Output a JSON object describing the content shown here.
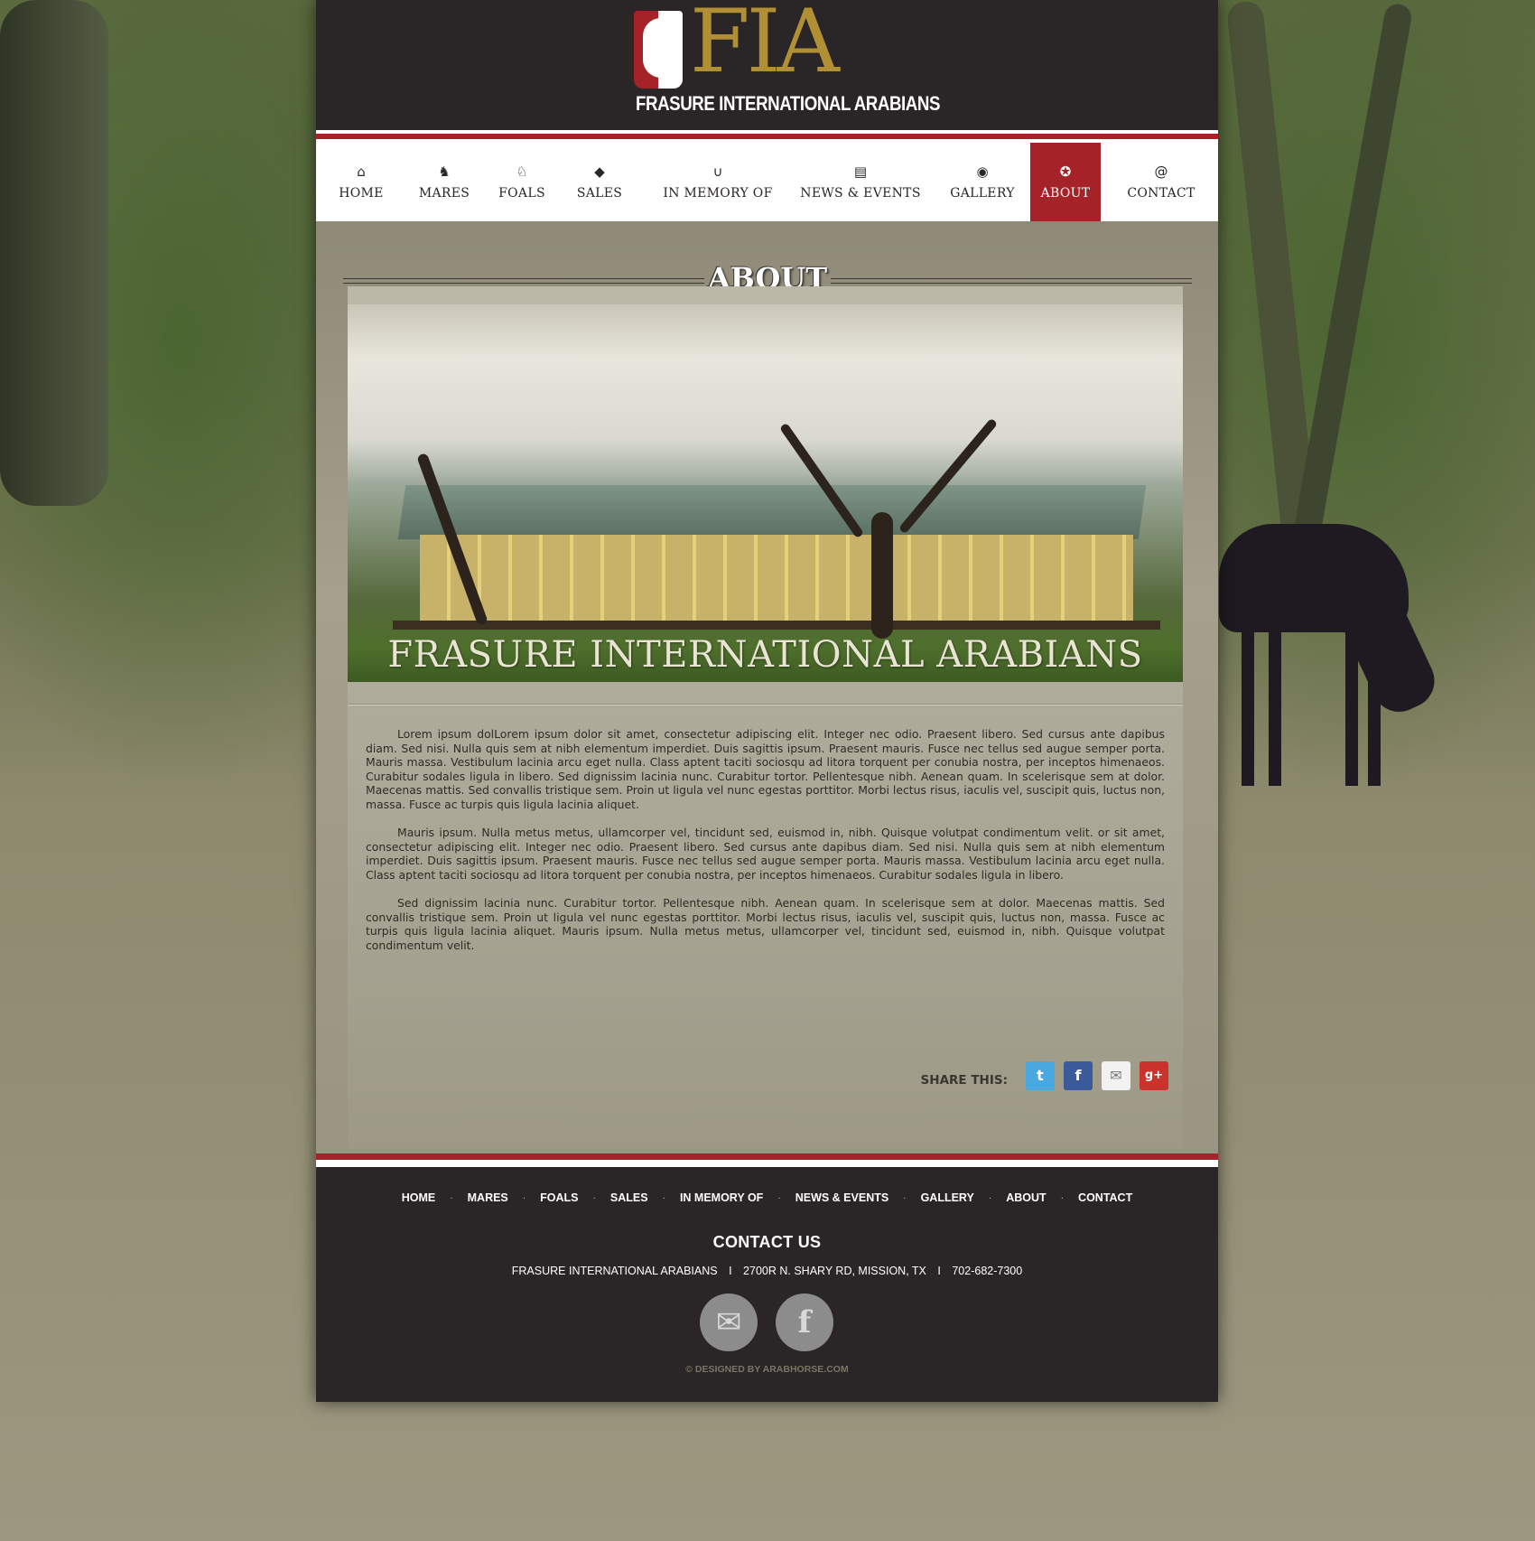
{
  "brand": {
    "logo_mark": "FIA",
    "logo_subtitle": "FRASURE INTERNATIONAL ARABIANS",
    "colors": {
      "red": "#a52328",
      "gold": "#b08f35",
      "dark": "#2a2526"
    }
  },
  "nav": {
    "items": [
      {
        "label": "HOME",
        "icon": "home-icon",
        "glyph": "⌂"
      },
      {
        "label": "MARES",
        "icon": "horse-head-icon",
        "glyph": "♞"
      },
      {
        "label": "FOALS",
        "icon": "foal-icon",
        "glyph": "♘"
      },
      {
        "label": "SALES",
        "icon": "tag-icon",
        "glyph": "◆"
      },
      {
        "label": "IN MEMORY OF",
        "icon": "horseshoe-icon",
        "glyph": "∪"
      },
      {
        "label": "NEWS & EVENTS",
        "icon": "newspaper-icon",
        "glyph": "▤"
      },
      {
        "label": "GALLERY",
        "icon": "camera-icon",
        "glyph": "◉"
      },
      {
        "label": "ABOUT",
        "icon": "star-badge-icon",
        "glyph": "✪"
      },
      {
        "label": "CONTACT",
        "icon": "at-icon",
        "glyph": "@"
      }
    ],
    "active": "ABOUT"
  },
  "main": {
    "title": "ABOUT",
    "hero_caption": "FRASURE INTERNATIONAL ARABIANS",
    "paragraphs": [
      "Lorem ipsum dolLorem ipsum dolor sit amet, consectetur adipiscing elit. Integer nec odio. Praesent libero. Sed cursus ante dapibus diam. Sed nisi. Nulla quis sem at nibh elementum imperdiet. Duis sagittis ipsum. Praesent mauris. Fusce nec tellus sed augue semper porta. Mauris massa. Vestibulum lacinia arcu eget nulla. Class aptent taciti sociosqu ad litora torquent per conubia nostra, per inceptos himenaeos. Curabitur sodales ligula in libero. Sed dignissim lacinia nunc. Curabitur tortor. Pellentesque nibh. Aenean quam. In scelerisque sem at dolor. Maecenas mattis. Sed convallis tristique sem. Proin ut ligula vel nunc egestas porttitor. Morbi lectus risus, iaculis vel, suscipit quis, luctus non, massa. Fusce ac turpis quis ligula lacinia aliquet.",
      "Mauris ipsum. Nulla metus metus, ullamcorper vel, tincidunt sed, euismod in, nibh. Quisque volutpat condimentum velit. or sit amet, consectetur adipiscing elit. Integer nec odio. Praesent libero. Sed cursus ante dapibus diam. Sed nisi. Nulla quis sem at nibh elementum imperdiet. Duis sagittis ipsum. Praesent mauris. Fusce nec tellus sed augue semper porta. Mauris massa. Vestibulum lacinia arcu eget nulla. Class aptent taciti sociosqu ad litora torquent per conubia nostra, per inceptos himenaeos. Curabitur sodales ligula in libero.",
      "Sed dignissim lacinia nunc. Curabitur tortor. Pellentesque nibh. Aenean quam. In scelerisque sem at dolor. Maecenas mattis. Sed convallis tristique sem. Proin ut ligula vel nunc egestas porttitor. Morbi lectus risus, iaculis vel, suscipit quis, luctus non, massa. Fusce ac turpis quis ligula lacinia aliquet. Mauris ipsum. Nulla metus metus, ullamcorper vel, tincidunt sed, euismod in, nibh. Quisque volutpat condimentum velit."
    ],
    "share": {
      "label": "SHARE THIS:",
      "buttons": [
        {
          "icon": "twitter-icon",
          "glyph": "t",
          "color": "#4aa8e0"
        },
        {
          "icon": "facebook-icon",
          "glyph": "f",
          "color": "#3b5a9a"
        },
        {
          "icon": "email-icon",
          "glyph": "✉",
          "color": "#f2f2f2"
        },
        {
          "icon": "google-plus-icon",
          "glyph": "g+",
          "color": "#c9332b"
        }
      ]
    }
  },
  "footer": {
    "nav": [
      "HOME",
      "MARES",
      "FOALS",
      "SALES",
      "IN MEMORY OF",
      "NEWS & EVENTS",
      "GALLERY",
      "ABOUT",
      "CONTACT"
    ],
    "separator": "·",
    "contact_heading": "CONTACT US",
    "contact_name": "FRASURE INTERNATIONAL ARABIANS",
    "contact_address": "2700R N. SHARY RD, MISSION, TX",
    "contact_phone": "702-682-7300",
    "contact_sep": "I",
    "circle_buttons": [
      {
        "icon": "mail-icon",
        "glyph": "✉"
      },
      {
        "icon": "facebook-icon",
        "glyph": "f"
      }
    ],
    "credit": "© DESIGNED BY ARABHORSE.COM"
  }
}
